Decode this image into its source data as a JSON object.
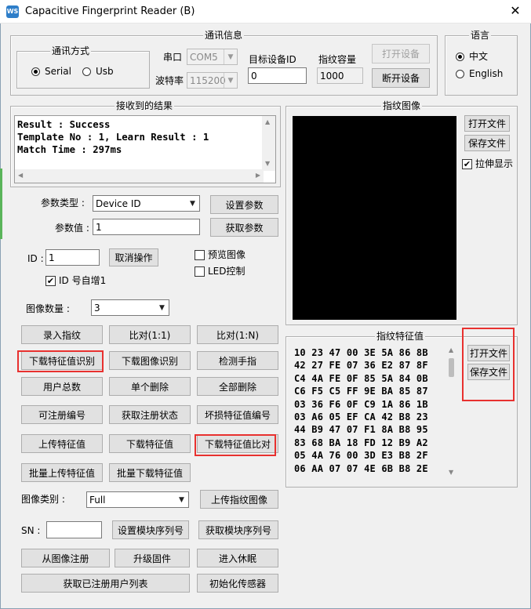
{
  "window": {
    "title": "Capacitive Fingerprint Reader (B)",
    "icon_text": "WS",
    "close_glyph": "✕"
  },
  "comm": {
    "group_label": "通讯信息",
    "mode_group_label": "通讯方式",
    "mode_options": [
      "Serial",
      "Usb"
    ],
    "mode_selected": "Serial",
    "port_label": "串口",
    "port_value": "COM5",
    "baud_label": "波特率",
    "baud_value": "115200",
    "target_id_label": "目标设备ID",
    "target_id_value": "0",
    "capacity_label": "指纹容量",
    "capacity_value": "1000",
    "open_device": "打开设备",
    "close_device": "断开设备"
  },
  "language": {
    "group_label": "语言",
    "options": [
      "中文",
      "English"
    ],
    "selected": "中文"
  },
  "result": {
    "group_label": "接收到的结果",
    "lines": [
      "Result : Success",
      "Template No : 1, Learn Result : 1",
      "Match Time : 297ms"
    ]
  },
  "image": {
    "group_label": "指纹图像",
    "open_file": "打开文件",
    "save_file": "保存文件",
    "stretch_label": "拉伸显示",
    "stretch_checked": true
  },
  "params": {
    "type_label": "参数类型 :",
    "type_value": "Device ID",
    "value_label": "参数值 :",
    "value": "1",
    "set_button": "设置参数",
    "get_button": "获取参数"
  },
  "id_section": {
    "id_label": "ID :",
    "id_value": "1",
    "cancel_button": "取消操作",
    "preview_label": "预览图像",
    "led_label": "LED控制",
    "auto_inc_label": "ID 号自增1",
    "auto_inc_checked": true
  },
  "image_count": {
    "label": "图像数量 :",
    "value": "3"
  },
  "buttons": {
    "enroll": "录入指纹",
    "match_1_1": "比对(1:1)",
    "match_1_n": "比对(1:N)",
    "download_feature_identify": "下载特征值识别",
    "download_image_identify": "下载图像识别",
    "detect_finger": "检测手指",
    "user_total": "用户总数",
    "delete_one": "单个删除",
    "delete_all": "全部删除",
    "available_id": "可注册编号",
    "get_enroll_status": "获取注册状态",
    "bad_feature_id": "坏损特征值编号",
    "upload_feature": "上传特征值",
    "download_feature": "下载特征值",
    "download_feature_compare": "下载特征值比对",
    "batch_upload": "批量上传特征值",
    "batch_download": "批量下载特征值",
    "upload_image": "上传指纹图像",
    "set_sn": "设置模块序列号",
    "get_sn": "获取模块序列号",
    "enroll_from_image": "从图像注册",
    "upgrade_firmware": "升级固件",
    "sleep": "进入休眠",
    "get_user_list": "获取已注册用户列表",
    "init_sensor": "初始化传感器"
  },
  "image_type": {
    "label": "图像类别 :",
    "value": "Full"
  },
  "sn": {
    "label": "SN :",
    "value": ""
  },
  "feature": {
    "group_label": "指纹特征值",
    "open_file": "打开文件",
    "save_file": "保存文件",
    "hex_rows": [
      "10 23 47 00 3E 5A 86 8B",
      "42 27 FE 07 36 E2 87 8F",
      "C4 4A FE 0F 85 5A 84 0B",
      "C6 F5 C5 FF 9E BA 85 87",
      "03 36 F6 0F C9 1A 86 1B",
      "03 A6 05 EF CA 42 B8 23",
      "44 B9 47 07 F1 8A B8 95",
      "83 68 BA 18 FD 12 B9 A2",
      "05 4A 76 00 3D E3 B8 2F",
      "06 AA 07 07 4E 6B B8 2E"
    ]
  },
  "colors": {
    "highlight": "#e8312f",
    "image_bg": "#000000",
    "window_bg": "#f0f0f0"
  }
}
